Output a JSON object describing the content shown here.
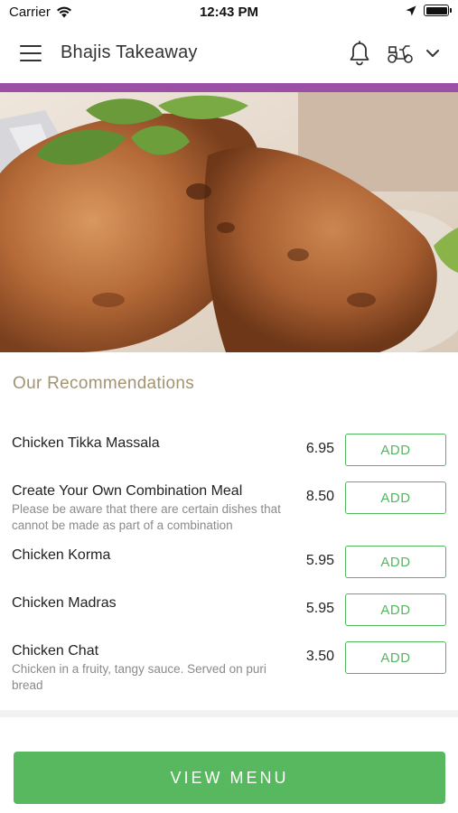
{
  "status_bar": {
    "carrier": "Carrier",
    "time": "12:43 PM"
  },
  "header": {
    "title": "Bhajis Takeaway"
  },
  "colors": {
    "accent": "#9b4fa5",
    "primary_green": "#57b85f",
    "section_title": "#a39371"
  },
  "section": {
    "title": "Our Recommendations"
  },
  "items": [
    {
      "name": "Chicken Tikka Massala",
      "description": "",
      "price": "6.95",
      "add_label": "ADD"
    },
    {
      "name": "Create Your Own Combination Meal",
      "description": "Please be aware that there are certain dishes that cannot be made as part of a combination",
      "price": "8.50",
      "add_label": "ADD"
    },
    {
      "name": "Chicken Korma",
      "description": "",
      "price": "5.95",
      "add_label": "ADD"
    },
    {
      "name": "Chicken Madras",
      "description": "",
      "price": "5.95",
      "add_label": "ADD"
    },
    {
      "name": "Chicken Chat",
      "description": "Chicken in a fruity, tangy sauce. Served on puri bread",
      "price": "3.50",
      "add_label": "ADD"
    }
  ],
  "footer": {
    "view_menu_label": "VIEW MENU"
  },
  "icons": {
    "menu": "hamburger-menu-icon",
    "notifications": "bell-icon",
    "delivery": "scooter-icon",
    "expand": "chevron-down-icon"
  }
}
